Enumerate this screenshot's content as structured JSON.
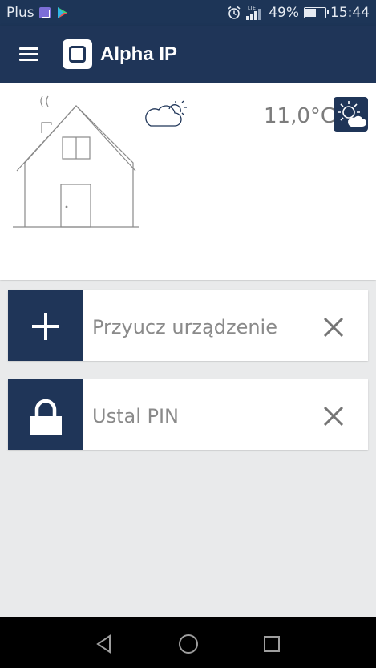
{
  "status_bar": {
    "carrier": "Plus",
    "network": "LTE",
    "battery_text": "49%",
    "battery_level": 0.49,
    "time": "15:44",
    "icons": [
      "gallery-icon",
      "play-store-icon",
      "alarm-icon",
      "signal-icon",
      "battery-icon"
    ]
  },
  "app_bar": {
    "title": "Alpha IP",
    "menu_icon": "hamburger-icon",
    "logo_icon": "alpha-ip-logo"
  },
  "home": {
    "temperature": "11,0°C",
    "weather_icon": "partly-cloudy-icon",
    "weather_button_icon": "sun-cloud-icon"
  },
  "actions": [
    {
      "label": "Przyucz urządzenie",
      "icon": "plus-icon",
      "dismiss_icon": "close-icon"
    },
    {
      "label": "Ustal PIN",
      "icon": "lock-icon",
      "dismiss_icon": "close-icon"
    }
  ],
  "nav_bar": {
    "buttons": [
      "back-icon",
      "home-icon",
      "recents-icon"
    ]
  },
  "colors": {
    "primary": "#1f3558",
    "status_bar": "#1d3557",
    "background": "#e9eaeb",
    "card": "#ffffff",
    "muted_text": "#8a8a8a"
  }
}
